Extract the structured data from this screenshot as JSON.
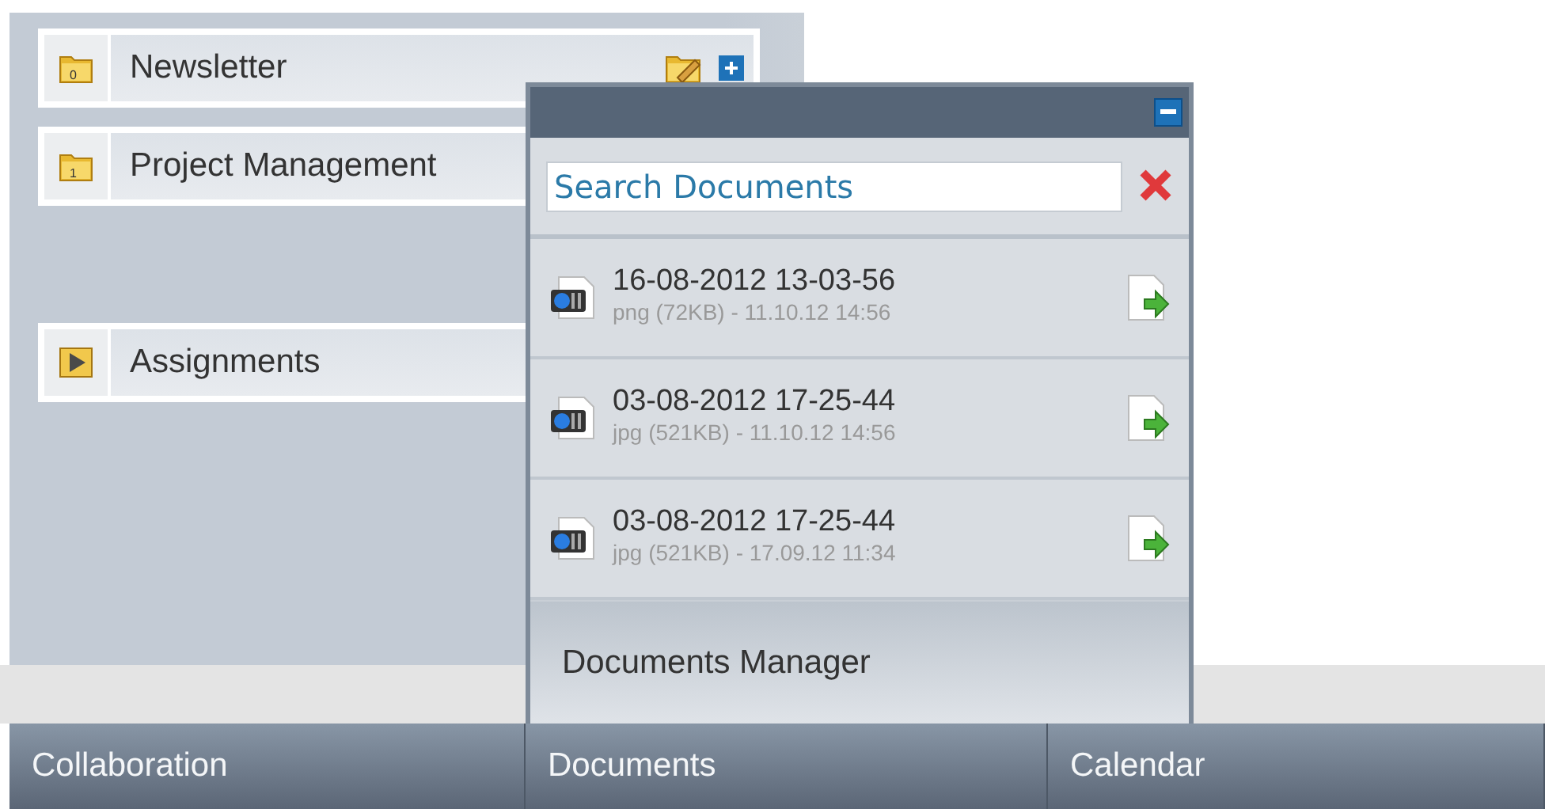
{
  "sidebar": {
    "items": [
      {
        "label": "Newsletter",
        "kind": "folder",
        "count": "0",
        "editable": true
      },
      {
        "label": "Project Management",
        "kind": "folder",
        "count": "1"
      },
      {
        "label": "Assignments",
        "kind": "assignment"
      }
    ]
  },
  "documents_popup": {
    "search": {
      "placeholder": "Search Documents"
    },
    "files": [
      {
        "name": "16-08-2012 13-03-56",
        "meta": "png (72KB) - 11.10.12 14:56"
      },
      {
        "name": "03-08-2012 17-25-44",
        "meta": "jpg (521KB) - 11.10.12 14:56"
      },
      {
        "name": "03-08-2012 17-25-44",
        "meta": "jpg (521KB) - 17.09.12 11:34"
      }
    ],
    "footer": "Documents Manager"
  },
  "bottom_bar": {
    "tabs": [
      "Collaboration",
      "Documents",
      "Calendar"
    ]
  }
}
